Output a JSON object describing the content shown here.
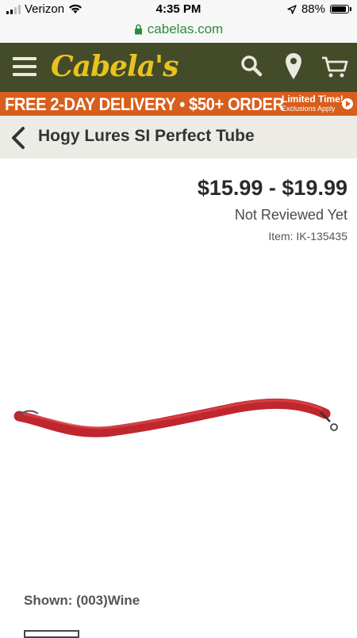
{
  "status_bar": {
    "carrier": "Verizon",
    "time": "4:35 PM",
    "battery": "88%",
    "battery_level": 0.88
  },
  "browser": {
    "url": "cabelas.com"
  },
  "header": {
    "logo_text": "Cabela's",
    "icons": [
      "hamburger-menu-icon",
      "search-icon",
      "location-pin-icon",
      "cart-icon"
    ],
    "bg_color": "#434b29",
    "logo_color": "#e8c21f"
  },
  "promo": {
    "main": "FREE 2-DAY DELIVERY • $50+ ORDER",
    "limited": "Limited Time!",
    "exclusions": "Exclusions Apply",
    "bg_color": "#d75e1d"
  },
  "breadcrumb": {
    "title": "Hogy Lures SI Perfect Tube"
  },
  "product": {
    "price": "$15.99 - $19.99",
    "reviews": "Not Reviewed Yet",
    "item_number": "Item: IK-135435",
    "lure_color": "#c0262e"
  },
  "shown": {
    "label": "Shown: (003)Wine"
  }
}
